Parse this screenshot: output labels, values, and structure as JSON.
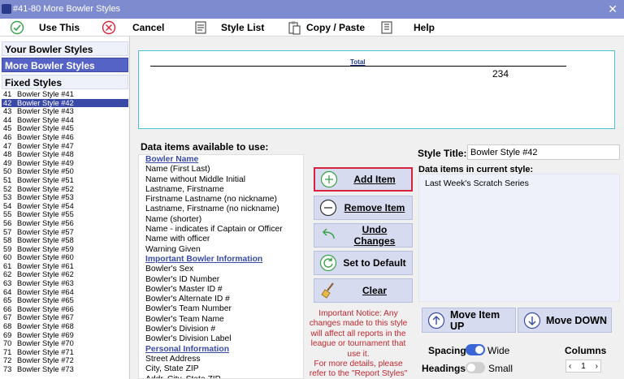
{
  "window": {
    "title": "#41-80 More Bowler Styles"
  },
  "toolbar": {
    "use_this": "Use This",
    "cancel": "Cancel",
    "style_list": "Style List",
    "copy_paste": "Copy / Paste",
    "help": "Help"
  },
  "sidebar": {
    "your_styles": "Your Bowler Styles",
    "more_styles": "More Bowler Styles",
    "fixed_styles": "Fixed Styles"
  },
  "styles": [
    {
      "num": "41",
      "name": "Bowler Style #41"
    },
    {
      "num": "42",
      "name": "Bowler Style #42"
    },
    {
      "num": "43",
      "name": "Bowler Style #43"
    },
    {
      "num": "44",
      "name": "Bowler Style #44"
    },
    {
      "num": "45",
      "name": "Bowler Style #45"
    },
    {
      "num": "46",
      "name": "Bowler Style #46"
    },
    {
      "num": "47",
      "name": "Bowler Style #47"
    },
    {
      "num": "48",
      "name": "Bowler Style #48"
    },
    {
      "num": "49",
      "name": "Bowler Style #49"
    },
    {
      "num": "50",
      "name": "Bowler Style #50"
    },
    {
      "num": "51",
      "name": "Bowler Style #51"
    },
    {
      "num": "52",
      "name": "Bowler Style #52"
    },
    {
      "num": "53",
      "name": "Bowler Style #53"
    },
    {
      "num": "54",
      "name": "Bowler Style #54"
    },
    {
      "num": "55",
      "name": "Bowler Style #55"
    },
    {
      "num": "56",
      "name": "Bowler Style #56"
    },
    {
      "num": "57",
      "name": "Bowler Style #57"
    },
    {
      "num": "58",
      "name": "Bowler Style #58"
    },
    {
      "num": "59",
      "name": "Bowler Style #59"
    },
    {
      "num": "60",
      "name": "Bowler Style #60"
    },
    {
      "num": "61",
      "name": "Bowler Style #61"
    },
    {
      "num": "62",
      "name": "Bowler Style #62"
    },
    {
      "num": "63",
      "name": "Bowler Style #63"
    },
    {
      "num": "64",
      "name": "Bowler Style #64"
    },
    {
      "num": "65",
      "name": "Bowler Style #65"
    },
    {
      "num": "66",
      "name": "Bowler Style #66"
    },
    {
      "num": "67",
      "name": "Bowler Style #67"
    },
    {
      "num": "68",
      "name": "Bowler Style #68"
    },
    {
      "num": "69",
      "name": "Bowler Style #69"
    },
    {
      "num": "70",
      "name": "Bowler Style #70"
    },
    {
      "num": "71",
      "name": "Bowler Style #71"
    },
    {
      "num": "72",
      "name": "Bowler Style #72"
    },
    {
      "num": "73",
      "name": "Bowler Style #73"
    }
  ],
  "selected_style_index": 1,
  "preview": {
    "title": "Total",
    "value": "234"
  },
  "available": {
    "heading": "Data items available to use:",
    "items": [
      {
        "text": "Bowler Name",
        "header": true
      },
      {
        "text": "Name (First Last)",
        "header": false
      },
      {
        "text": "Name without Middle Initial",
        "header": false
      },
      {
        "text": "Lastname, Firstname",
        "header": false
      },
      {
        "text": "Firstname Lastname (no nickname)",
        "header": false
      },
      {
        "text": "Lastname, Firstname (no nickname)",
        "header": false
      },
      {
        "text": "Name (shorter)",
        "header": false
      },
      {
        "text": "Name - indicates if Captain or Officer",
        "header": false
      },
      {
        "text": "Name with officer",
        "header": false
      },
      {
        "text": "Warning Given",
        "header": false
      },
      {
        "text": "Important Bowler Information",
        "header": true
      },
      {
        "text": "Bowler's Sex",
        "header": false
      },
      {
        "text": "Bowler's ID Number",
        "header": false
      },
      {
        "text": "Bowler's Master ID #",
        "header": false
      },
      {
        "text": "Bowler's Alternate ID #",
        "header": false
      },
      {
        "text": "Bowler's Team Number",
        "header": false
      },
      {
        "text": "Bowler's Team Name",
        "header": false
      },
      {
        "text": "Bowler's Division #",
        "header": false
      },
      {
        "text": "Bowler's Division Label",
        "header": false
      },
      {
        "text": "Personal Information",
        "header": true
      },
      {
        "text": "Street Address",
        "header": false
      },
      {
        "text": "City, State ZIP",
        "header": false
      },
      {
        "text": "Addr, City, State ZIP",
        "header": false
      }
    ]
  },
  "actions": {
    "add_item": "Add Item",
    "remove_item": "Remove Item",
    "undo_changes": "Undo Changes",
    "set_default": "Set to Default",
    "clear": "Clear"
  },
  "notice": {
    "text": "Important Notice: Any changes made to this style will affect all reports in the league or tournament that use it.",
    "more": "For more details, please refer to the \"Report Styles\""
  },
  "style_title": {
    "label": "Style Title:",
    "value": "Bowler Style #42"
  },
  "current": {
    "heading": "Data items in current style:",
    "items": [
      "Last Week's Scratch Series"
    ]
  },
  "move": {
    "up": "Move Item UP",
    "down": "Move DOWN"
  },
  "options": {
    "spacing_label": "Spacing",
    "spacing_value": "Wide",
    "spacing_on": true,
    "headings_label": "Headings",
    "headings_value": "Small",
    "headings_on": false,
    "columns_label": "Columns",
    "columns_value": "1"
  },
  "colors": {
    "titlebar": "#7f8bcf",
    "nav_active": "#5563c6",
    "list_selected": "#3a48a6",
    "button_bg": "#d6dbef",
    "highlight_border": "#d9223c",
    "notice_text": "#c0282f",
    "toggle_on": "#3a66d6"
  }
}
